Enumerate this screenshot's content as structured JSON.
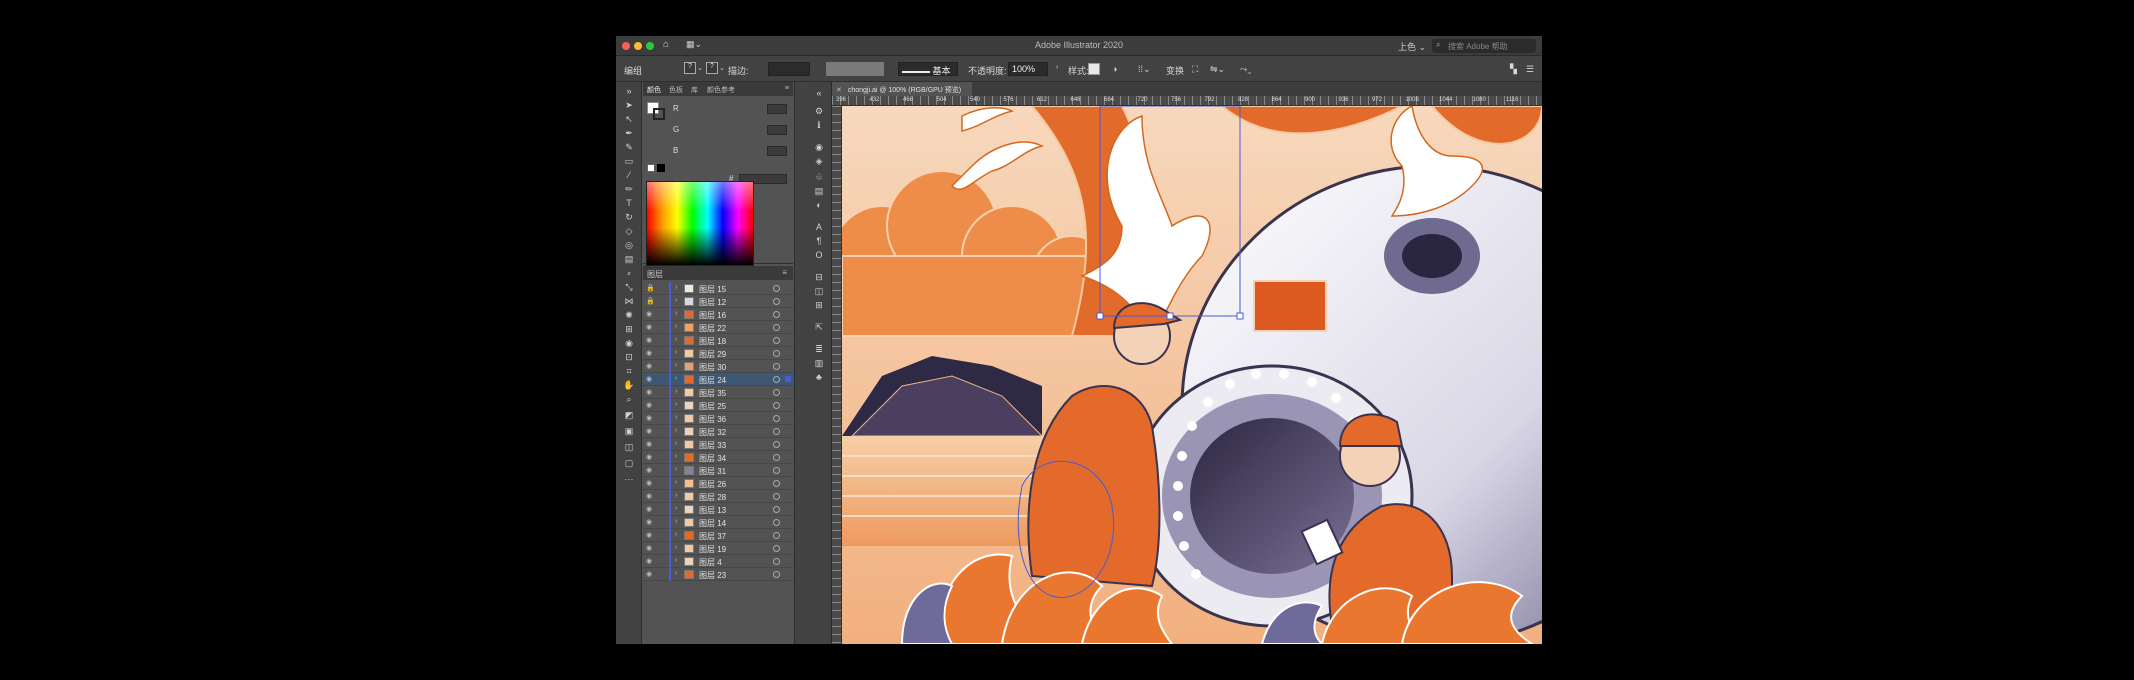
{
  "window": {
    "title": "Adobe Illustrator 2020",
    "workspace": "上色 ⌄",
    "search_placeholder": "搜索 Adobe 帮助"
  },
  "controlbar": {
    "mode_label": "编组",
    "stroke_label": "描边:",
    "stroke_style": "基本",
    "opacity_label": "不透明度:",
    "opacity_value": "100%",
    "style_label": "样式:",
    "transform_label": "变换"
  },
  "color_panel": {
    "tabs": [
      "颜色",
      "色板",
      "库",
      "颜色参考"
    ],
    "channels": [
      "R",
      "G",
      "B"
    ],
    "hex_label": "#"
  },
  "layers_panel": {
    "title": "图层",
    "layers": [
      {
        "name": "图层 15",
        "selected": false
      },
      {
        "name": "图层 12",
        "selected": false
      },
      {
        "name": "图层 16",
        "selected": false
      },
      {
        "name": "图层 22",
        "selected": false
      },
      {
        "name": "图层 18",
        "selected": false
      },
      {
        "name": "图层 29",
        "selected": false
      },
      {
        "name": "图层 30",
        "selected": false
      },
      {
        "name": "图层 24",
        "selected": true
      },
      {
        "name": "图层 35",
        "selected": false
      },
      {
        "name": "图层 25",
        "selected": false
      },
      {
        "name": "图层 36",
        "selected": false
      },
      {
        "name": "图层 32",
        "selected": false
      },
      {
        "name": "图层 33",
        "selected": false
      },
      {
        "name": "图层 34",
        "selected": false
      },
      {
        "name": "图层 31",
        "selected": false
      },
      {
        "name": "图层 26",
        "selected": false
      },
      {
        "name": "图层 28",
        "selected": false
      },
      {
        "name": "图层 13",
        "selected": false
      },
      {
        "name": "图层 14",
        "selected": false
      },
      {
        "name": "图层 37",
        "selected": false
      },
      {
        "name": "图层 19",
        "selected": false
      },
      {
        "name": "图层 4",
        "selected": false
      },
      {
        "name": "图层 23",
        "selected": false
      }
    ]
  },
  "document": {
    "tab_label": "chongji.ai @ 100% (RGB/GPU 预览)",
    "ruler_ticks": [
      "396",
      "432",
      "468",
      "504",
      "540",
      "576",
      "612",
      "648",
      "684",
      "720",
      "756",
      "792",
      "828",
      "864",
      "900",
      "936",
      "972",
      "1008",
      "1044",
      "1080",
      "1116"
    ]
  },
  "colors": {
    "accent_orange": "#e0652a",
    "selection_blue": "#4a5bd4",
    "panel_bg": "#535353"
  }
}
